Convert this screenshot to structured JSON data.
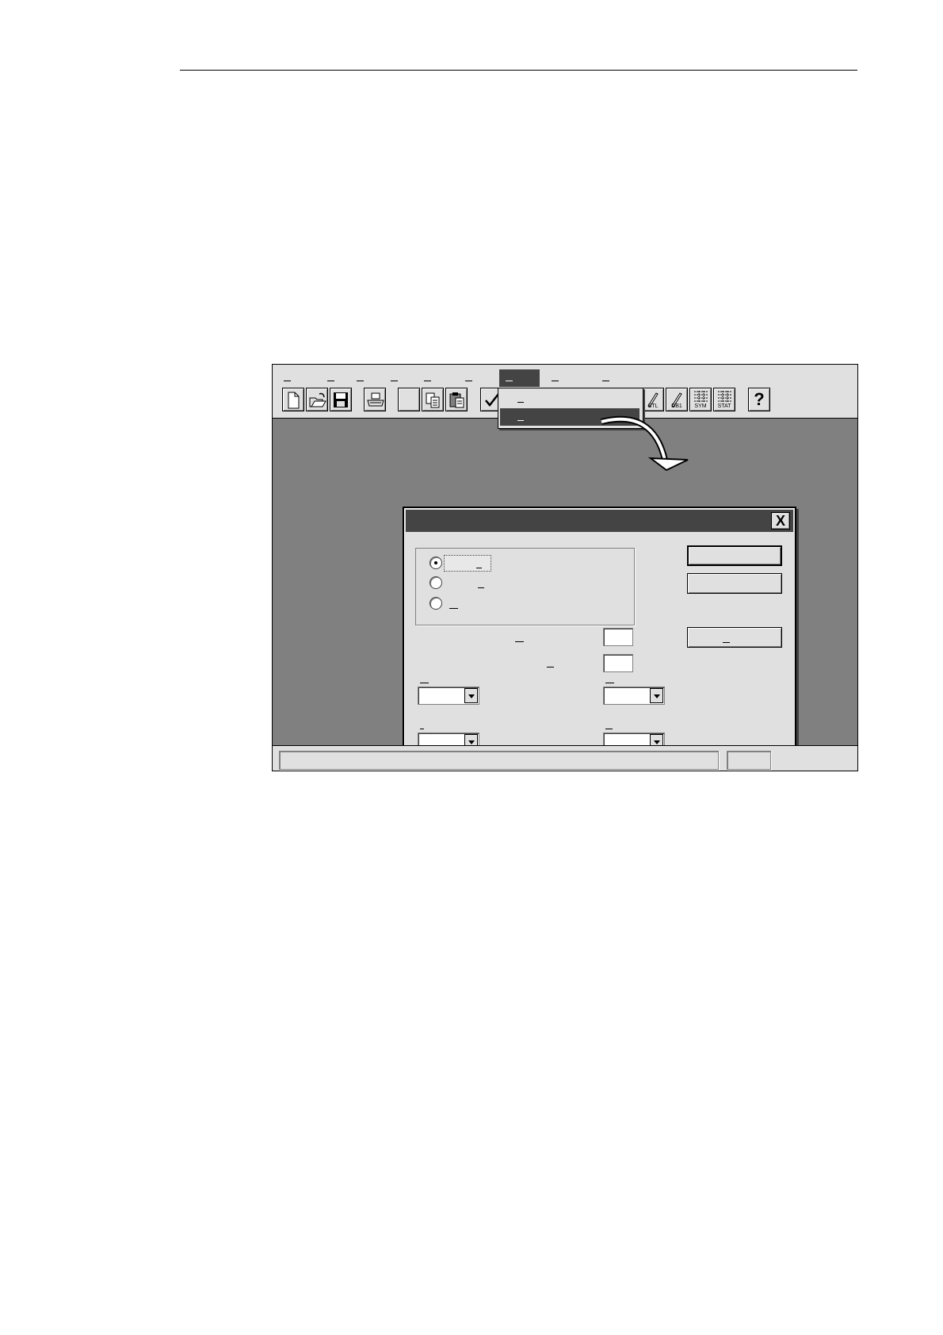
{
  "window": {
    "menu_bar": {
      "items": [
        "",
        "",
        "",
        "",
        "",
        "",
        "",
        "",
        ""
      ],
      "active_index": 6
    },
    "toolbar": {
      "buttons": [
        "new-file",
        "open-folder",
        "save-disk",
        "print",
        "blank",
        "copy",
        "paste",
        "check",
        "edit-stl",
        "edit-db1",
        "grid-sym",
        "grid-stat",
        "help"
      ],
      "labels": {
        "stl": "STL",
        "db1": "DB1",
        "sym": "SYM",
        "stat": "STAT",
        "help": "?"
      }
    },
    "dropdown_menu": {
      "items": [
        "",
        ""
      ],
      "selected_index": 1
    },
    "dialog": {
      "close_label": "X",
      "radio_group": {
        "options": [
          "",
          "",
          ""
        ],
        "selected_index": 0
      },
      "buttons": [
        "",
        "",
        ""
      ],
      "text_fields": [
        "",
        ""
      ],
      "dropdowns": [
        "",
        "",
        "",
        ""
      ]
    },
    "status_bar": {
      "panes": [
        "",
        ""
      ]
    }
  },
  "colors": {
    "workspace": "#808080",
    "title_bar": "#444444",
    "chrome": "#e0e0e0"
  }
}
